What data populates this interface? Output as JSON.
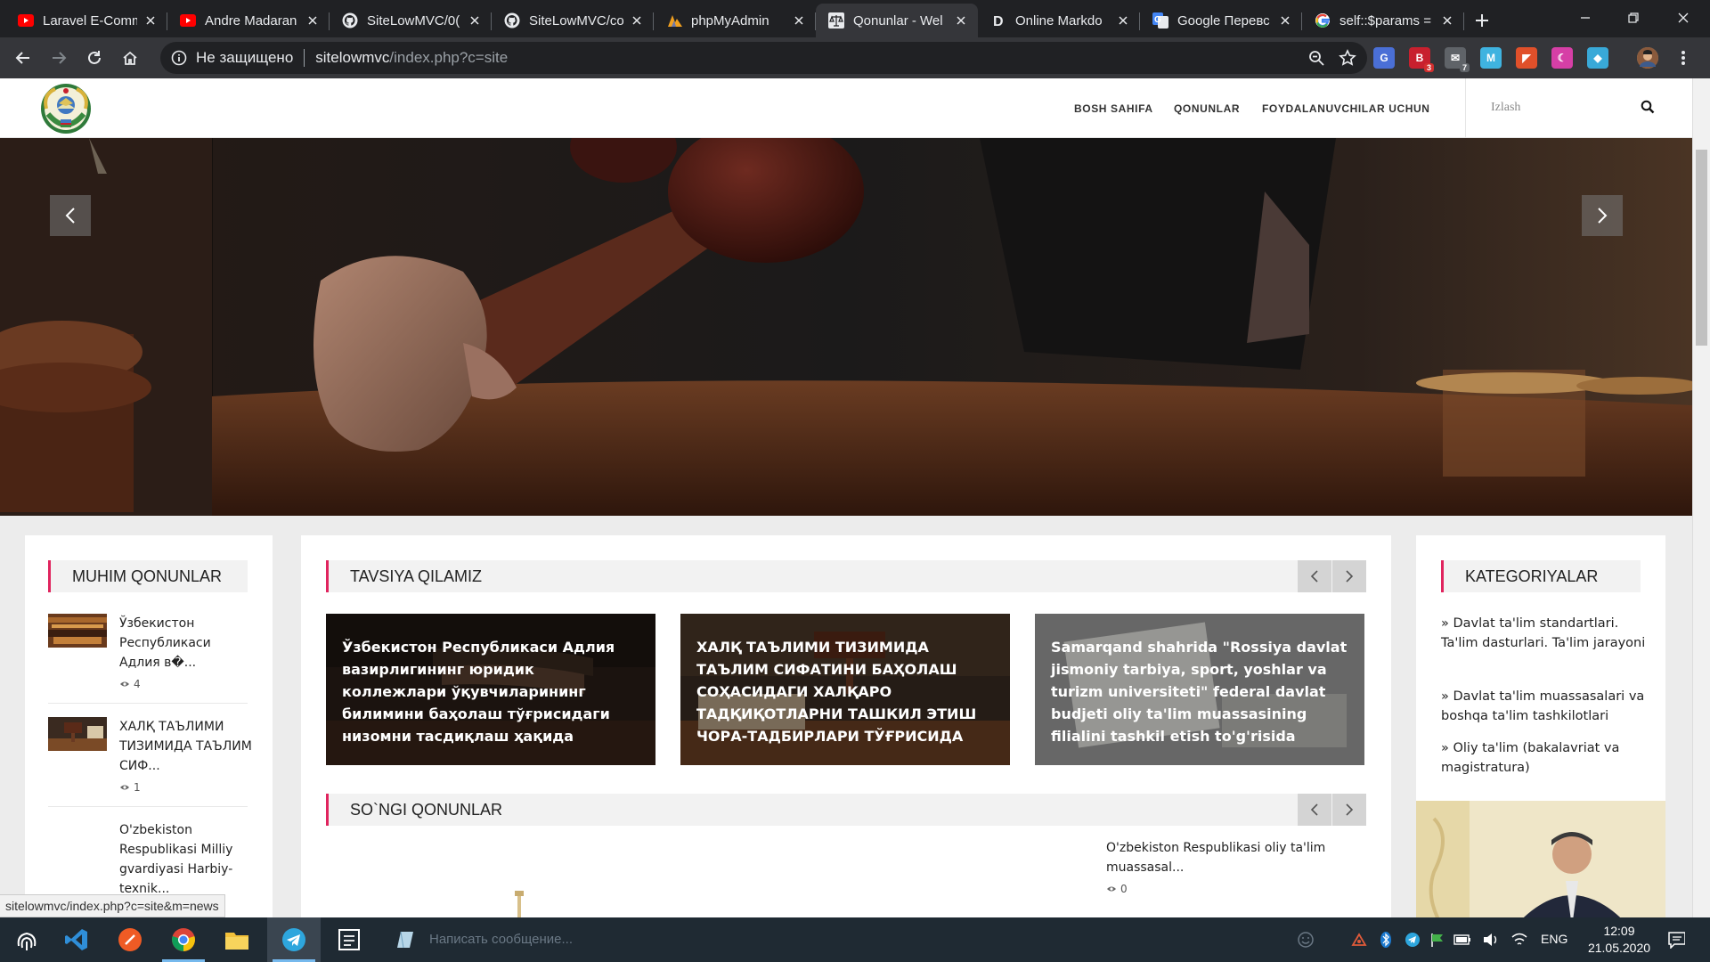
{
  "browser": {
    "tabs": [
      {
        "title": "Laravel E-Comm",
        "icon": "youtube-icon",
        "active": false
      },
      {
        "title": "Andre Madaran",
        "icon": "youtube-icon",
        "active": false
      },
      {
        "title": "SiteLowMVC/0(",
        "icon": "github-icon",
        "active": false
      },
      {
        "title": "SiteLowMVC/co",
        "icon": "github-icon",
        "active": false
      },
      {
        "title": "phpMyAdmin",
        "icon": "phpmyadmin-icon",
        "active": false
      },
      {
        "title": "Qonunlar - Wel",
        "icon": "scales-icon",
        "active": true
      },
      {
        "title": "Online Markdo",
        "icon": "dillinger-icon",
        "active": false
      },
      {
        "title": "Google Перевс",
        "icon": "google-translate-icon",
        "active": false
      },
      {
        "title": "self::$params =",
        "icon": "google-icon",
        "active": false
      }
    ],
    "security_label": "Не защищено",
    "url_host": "sitelowmvc",
    "url_path": "/index.php?c=site",
    "extensions": [
      {
        "name": "translate-ext-icon",
        "label": "G",
        "color": "#4a6fd6"
      },
      {
        "name": "bitrix-ext-icon",
        "label": "B",
        "color": "#c8202e",
        "badge": "3"
      },
      {
        "name": "mail-ext-icon",
        "label": "✉",
        "color": "#5f6368",
        "badge": "7"
      },
      {
        "name": "m-ext-icon",
        "label": "M",
        "color": "#3fb3e0"
      },
      {
        "name": "office-ext-icon",
        "label": "◤",
        "color": "#e0502a"
      },
      {
        "name": "moon-ext-icon",
        "label": "☾",
        "color": "#d63fa6"
      },
      {
        "name": "toggl-ext-icon",
        "label": "◆",
        "color": "#39a9d8"
      }
    ]
  },
  "site": {
    "nav": {
      "home": "BOSH SAHIFA",
      "laws": "QONUNLAR",
      "users": "FOYDALANUVCHILAR UCHUN"
    },
    "search_placeholder": "Izlash"
  },
  "sidebar_left": {
    "title": "MUHIM QONUNLAR",
    "items": [
      {
        "title": "Ўзбекистон Республикаси Адлия в�...",
        "views": "4"
      },
      {
        "title": "ХАЛҚ ТАЪЛИМИ ТИЗИМИДА ТАЪЛИМ СИФ...",
        "views": "1"
      },
      {
        "title": "O'zbekiston Respublikasi Milliy gvardiyasi Harbiy-texnik..."
      }
    ]
  },
  "recommend": {
    "title": "TAVSIYA QILAMIZ",
    "items": [
      {
        "caption": "Ўзбекистон Республикаси Адлия вазирлигининг юридик коллежлари ўқувчиларининг билимини баҳолаш тўғрисидаги низомни тасдиқлаш ҳақида"
      },
      {
        "caption": "ХАЛҚ ТАЪЛИМИ ТИЗИМИДА ТАЪЛИМ СИФАТИНИ БАҲОЛАШ СОҲАСИДАГИ ХАЛҚАРО ТАДҚИҚОТЛАРНИ ТАШКИЛ ЭТИШ ЧОРА-ТАДБИРЛАРИ ТЎҒРИСИДА"
      },
      {
        "caption": "Samarqand shahrida \"Rossiya davlat jismoniy tarbiya, sport, yoshlar va turizm universiteti\" federal davlat budjeti oliy ta'lim muassasining filialini tashkil etish to'g'risida"
      }
    ]
  },
  "latest": {
    "title": "SO`NGI QONUNLAR",
    "items": [
      {
        "title": "O'zbekiston Respublikasi oliy ta'lim muassasal...",
        "views": "0"
      }
    ]
  },
  "categories": {
    "title": "KATEGORIYALAR",
    "items": [
      "» Davlat ta'lim standartlari. Ta'lim dasturlari. Ta'lim jarayoni",
      "» Davlat ta'lim muassasalari va boshqa ta'lim tashkilotlari",
      "» Oliy ta'lim (bakalavriat va magistratura)"
    ]
  },
  "status_url": "sitelowmvc/index.php?c=site&m=news",
  "taskbar": {
    "ghost_text": "Написать сообщение...",
    "language": "ENG",
    "time": "12:09",
    "date": "21.05.2020"
  },
  "colors": {
    "accent": "#e0245e",
    "chrome_dark": "#202124",
    "chrome_toolbar": "#35363a",
    "taskbar": "#1f2a33"
  }
}
